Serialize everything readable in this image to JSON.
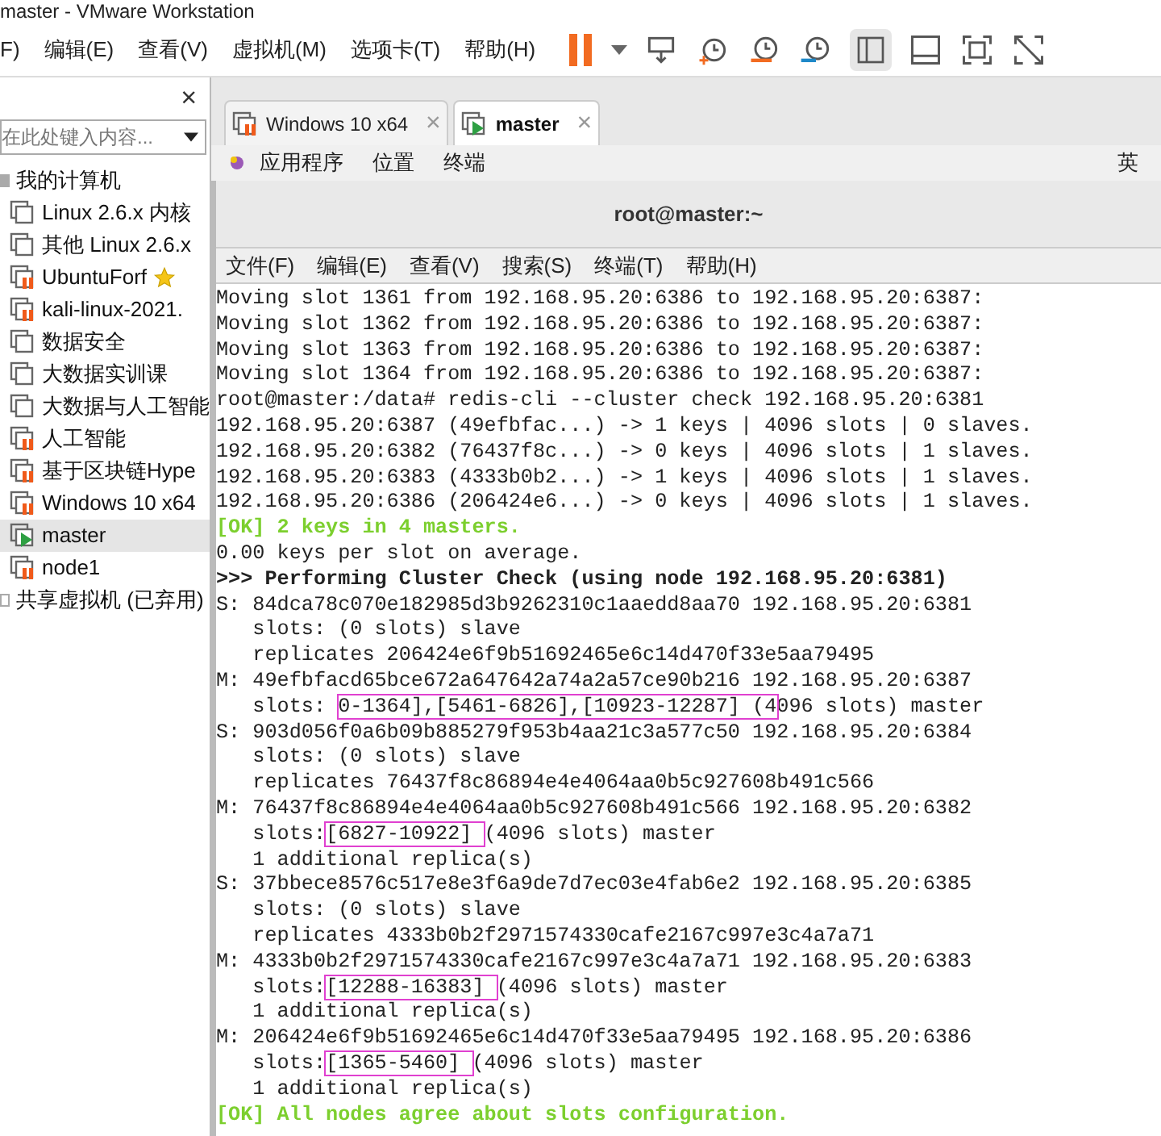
{
  "window": {
    "title": "master - VMware Workstation"
  },
  "menu": [
    "F)",
    "编辑(E)",
    "查看(V)",
    "虚拟机(M)",
    "选项卡(T)",
    "帮助(H)"
  ],
  "library": {
    "close": "×",
    "search": {
      "placeholder": "在此处键入内容..."
    },
    "tree": [
      {
        "label": "我的计算机",
        "expanded": true,
        "children": [
          {
            "label": "Linux 2.6.x 内核",
            "kind": "off",
            "selected": false,
            "favorite": false
          },
          {
            "label": "其他 Linux 2.6.x",
            "kind": "off",
            "selected": false,
            "favorite": false
          },
          {
            "label": "UbuntuForf",
            "kind": "paused",
            "selected": false,
            "favorite": true
          },
          {
            "label": "kali-linux-2021.",
            "kind": "paused",
            "selected": false,
            "favorite": false
          },
          {
            "label": "数据安全",
            "kind": "off",
            "selected": false,
            "favorite": false
          },
          {
            "label": "大数据实训课",
            "kind": "off",
            "selected": false,
            "favorite": false
          },
          {
            "label": "大数据与人工智能",
            "kind": "off",
            "selected": false,
            "favorite": false
          },
          {
            "label": "人工智能",
            "kind": "paused",
            "selected": false,
            "favorite": false
          },
          {
            "label": "基于区块链Hype",
            "kind": "paused",
            "selected": false,
            "favorite": false
          },
          {
            "label": "Windows 10 x64",
            "kind": "paused",
            "selected": false,
            "favorite": false
          },
          {
            "label": "master",
            "kind": "running",
            "selected": true,
            "favorite": false
          },
          {
            "label": "node1",
            "kind": "paused",
            "selected": false,
            "favorite": false
          }
        ]
      },
      {
        "label": "共享虚拟机 (已弃用)",
        "expanded": false
      }
    ]
  },
  "tabs": [
    {
      "label": "Windows 10 x64",
      "kind": "paused",
      "selected": false,
      "close": "×"
    },
    {
      "label": "master",
      "kind": "running",
      "selected": true,
      "close": "×"
    }
  ],
  "gnome_bar": {
    "items": [
      "应用程序",
      "位置",
      "终端"
    ],
    "input_method": "英"
  },
  "terminal": {
    "title": "root@master:~",
    "menu": [
      "文件(F)",
      "编辑(E)",
      "查看(V)",
      "搜索(S)",
      "终端(T)",
      "帮助(H)"
    ],
    "lines": [
      {
        "kind": "normal",
        "text": "Moving slot 1361 from 192.168.95.20:6386 to 192.168.95.20:6387:"
      },
      {
        "kind": "normal",
        "text": "Moving slot 1362 from 192.168.95.20:6386 to 192.168.95.20:6387:"
      },
      {
        "kind": "normal",
        "text": "Moving slot 1363 from 192.168.95.20:6386 to 192.168.95.20:6387:"
      },
      {
        "kind": "normal",
        "text": "Moving slot 1364 from 192.168.95.20:6386 to 192.168.95.20:6387:"
      },
      {
        "kind": "normal",
        "text": "root@master:/data# redis-cli --cluster check 192.168.95.20:6381"
      },
      {
        "kind": "normal",
        "text": "192.168.95.20:6387 (49efbfac...) -> 1 keys | 4096 slots | 0 slaves."
      },
      {
        "kind": "normal",
        "text": "192.168.95.20:6382 (76437f8c...) -> 0 keys | 4096 slots | 1 slaves."
      },
      {
        "kind": "normal",
        "text": "192.168.95.20:6383 (4333b0b2...) -> 1 keys | 4096 slots | 1 slaves."
      },
      {
        "kind": "normal",
        "text": "192.168.95.20:6386 (206424e6...) -> 0 keys | 4096 slots | 1 slaves."
      },
      {
        "kind": "ok",
        "text": "[OK] 2 keys in 4 masters."
      },
      {
        "kind": "normal",
        "text": "0.00 keys per slot on average."
      },
      {
        "kind": "header",
        "text": ">>> Performing Cluster Check (using node 192.168.95.20:6381)"
      },
      {
        "kind": "normal",
        "text": "S: 84dca78c070e182985d3b9262310c1aaedd8aa70 192.168.95.20:6381"
      },
      {
        "kind": "normal",
        "text": "   slots: (0 slots) slave"
      },
      {
        "kind": "normal",
        "text": "   replicates 206424e6f9b51692465e6c14d470f33e5aa79495"
      },
      {
        "kind": "normal",
        "text": "M: 49efbfacd65bce672a647642a74a2a57ce90b216 192.168.95.20:6387"
      },
      {
        "kind": "marked",
        "before": "   slots: ",
        "marked": "0-1364],[5461-6826],[10923-12287] (4",
        "after": "096 slots) master"
      },
      {
        "kind": "normal",
        "text": "S: 903d056f0a6b09b885279f953b4aa21c3a577c50 192.168.95.20:6384"
      },
      {
        "kind": "normal",
        "text": "   slots: (0 slots) slave"
      },
      {
        "kind": "normal",
        "text": "   replicates 76437f8c86894e4e4064aa0b5c927608b491c566"
      },
      {
        "kind": "normal",
        "text": "M: 76437f8c86894e4e4064aa0b5c927608b491c566 192.168.95.20:6382"
      },
      {
        "kind": "marked",
        "before": "   slots:",
        "marked": "[6827-10922] ",
        "after": "(4096 slots) master"
      },
      {
        "kind": "normal",
        "text": "   1 additional replica(s)"
      },
      {
        "kind": "normal",
        "text": "S: 37bbece8576c517e8e3f6a9de7d7ec03e4fab6e2 192.168.95.20:6385"
      },
      {
        "kind": "normal",
        "text": "   slots: (0 slots) slave"
      },
      {
        "kind": "normal",
        "text": "   replicates 4333b0b2f2971574330cafe2167c997e3c4a7a71"
      },
      {
        "kind": "normal",
        "text": "M: 4333b0b2f2971574330cafe2167c997e3c4a7a71 192.168.95.20:6383"
      },
      {
        "kind": "marked",
        "before": "   slots:",
        "marked": "[12288-16383] ",
        "after": "(4096 slots) master"
      },
      {
        "kind": "normal",
        "text": "   1 additional replica(s)"
      },
      {
        "kind": "normal",
        "text": "M: 206424e6f9b51692465e6c14d470f33e5aa79495 192.168.95.20:6386"
      },
      {
        "kind": "marked",
        "before": "   slots:",
        "marked": "[1365-5460] ",
        "after": "(4096 slots) master"
      },
      {
        "kind": "normal",
        "text": "   1 additional replica(s)"
      },
      {
        "kind": "ok",
        "text": "[OK] All nodes agree about slots configuration."
      }
    ]
  }
}
